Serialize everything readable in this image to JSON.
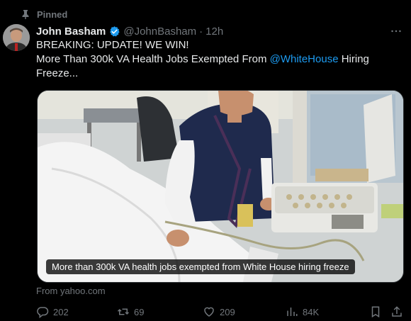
{
  "pinned": {
    "label": "Pinned"
  },
  "author": {
    "name": "John Basham",
    "handle": "@JohnBasham",
    "time": "12h"
  },
  "tweet": {
    "line1": "BREAKING: UPDATE! WE WIN!",
    "line2_prefix": "More Than 300k VA Health Jobs Exempted From ",
    "mention": "@WhiteHouse",
    "line2_suffix": " Hiring",
    "line3": "Freeze..."
  },
  "media": {
    "caption": "More than 300k VA health jobs exempted from White House hiring freeze"
  },
  "source": "From yahoo.com",
  "actions": {
    "replies": "202",
    "reposts": "69",
    "likes": "209",
    "views": "84K"
  },
  "colors": {
    "accent": "#1d9bf0",
    "muted": "#71767b",
    "text": "#e7e9ea",
    "background": "#000000"
  },
  "icons": [
    "pin-icon",
    "verified-icon",
    "more-icon",
    "reply-icon",
    "repost-icon",
    "like-icon",
    "views-icon",
    "bookmark-icon",
    "share-icon"
  ]
}
